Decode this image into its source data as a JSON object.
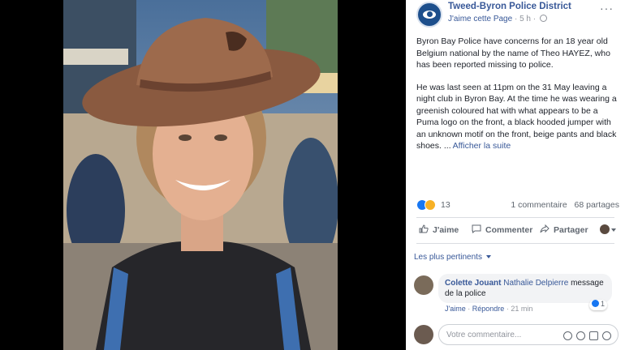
{
  "post": {
    "page_name": "Tweed-Byron Police District",
    "like_page": "J'aime cette Page",
    "separator": "·",
    "time": "5 h",
    "more": "···",
    "paragraph1": "Byron Bay Police have concerns for an 18 year old Belgium national by the name of Theo HAYEZ, who has been reported missing to police.",
    "paragraph2": "He was last seen at 11pm on the 31 May leaving a night club in Byron Bay. At the time he was wearing a greenish coloured hat with what appears to be a Puma logo on the front, a black hooded jumper with an unknown motif on the front, beige pants and black shoes. ...",
    "see_more": "Afficher la suite"
  },
  "stats": {
    "reaction_count": "13",
    "comments": "1 commentaire",
    "shares": "68 partages"
  },
  "actions": {
    "like": "J'aime",
    "comment": "Commenter",
    "share": "Partager"
  },
  "comments_section": {
    "filter_label": "Les plus pertinents",
    "comment": {
      "author": "Colette Jouant",
      "mention": "Nathalie Delpierre",
      "text": "message de la police",
      "like_label": "J'aime",
      "reply_label": "Répondre",
      "time": "21 min",
      "reaction_count": "1"
    },
    "reply_placeholder": "Votre commentaire..."
  },
  "colors": {
    "link": "#385898",
    "brand": "#1877f2",
    "text": "#1d2129",
    "muted": "#90949c"
  }
}
